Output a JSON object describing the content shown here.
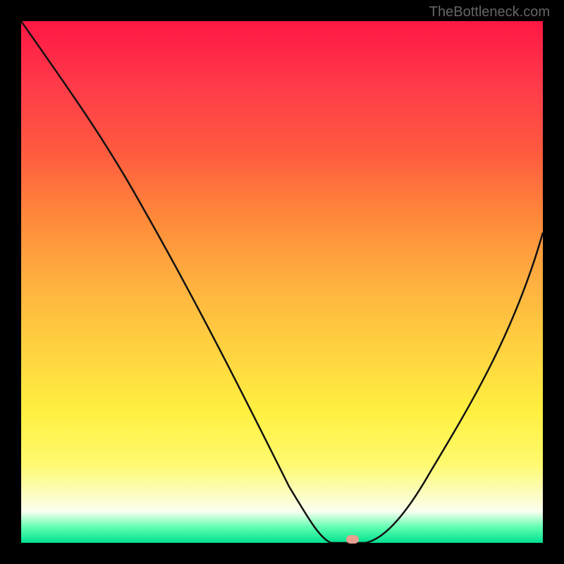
{
  "watermark": "TheBottleneck.com",
  "marker": {
    "x_pct": 63.5,
    "y_pct": 99.3
  },
  "chart_data": {
    "type": "line",
    "title": "",
    "xlabel": "",
    "ylabel": "",
    "xlim": [
      0,
      100
    ],
    "ylim": [
      0,
      100
    ],
    "x": [
      0,
      5,
      10,
      15,
      20,
      25,
      30,
      35,
      40,
      45,
      50,
      55,
      58,
      60,
      62,
      64,
      66,
      70,
      75,
      80,
      85,
      90,
      95,
      100
    ],
    "y": [
      100,
      93,
      86,
      78,
      71,
      62,
      53,
      44,
      35,
      26,
      16,
      7,
      2,
      0,
      0,
      0,
      0,
      3,
      10,
      19,
      28,
      37,
      48,
      60
    ],
    "notes": "Values are estimated from pixel positions as a fraction of the plot area (0-100 scale on both axes). Y represents height above the bottom (0 = green/optimal, 100 = red/worst). The curve has a flat minimum roughly between x=58 and x=66. A salmon-colored marker sits near x=63.5 on the baseline.",
    "gradient_colors": {
      "top": "#ff1744",
      "mid": "#ffd040",
      "bottom": "#00e090"
    },
    "marker_color": "#e8a090"
  }
}
